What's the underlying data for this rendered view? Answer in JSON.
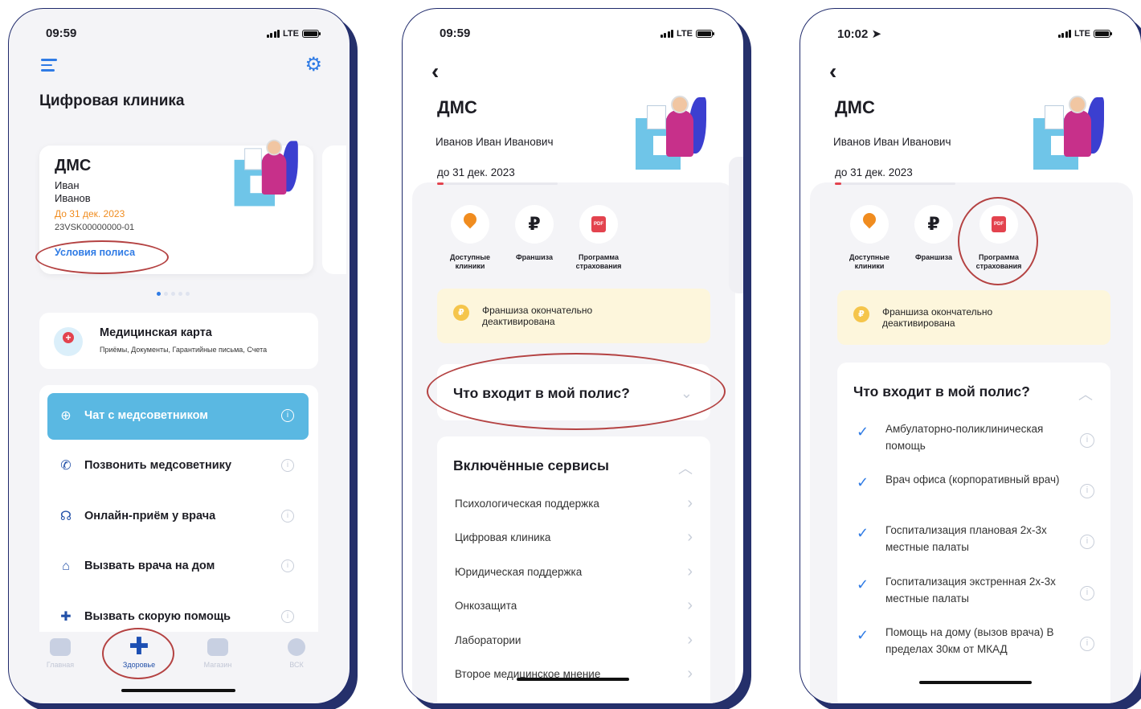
{
  "phone1": {
    "time": "09:59",
    "network": "LTE",
    "title": "Цифровая клиника",
    "card": {
      "heading": "ДМС",
      "first_name": "Иван",
      "last_name": "Иванов",
      "valid_until": "До 31 дек. 2023",
      "policy_number": "23VSK00000000-01",
      "conditions_link": "Условия полиса"
    },
    "medcard": {
      "title": "Медицинская карта",
      "subtitle": "Приёмы, Документы, Гарантийные письма, Счета"
    },
    "menu": [
      {
        "label": "Чат с медсоветником",
        "icon": "chat-icon"
      },
      {
        "label": "Позвонить медсоветнику",
        "icon": "phone-icon"
      },
      {
        "label": "Онлайн-приём у врача",
        "icon": "headset-icon"
      },
      {
        "label": "Вызвать врача на дом",
        "icon": "home-icon"
      },
      {
        "label": "Вызвать скорую помощь",
        "icon": "ambulance-icon"
      }
    ],
    "tabs": [
      {
        "label": "Главная",
        "icon": "home-tab-icon"
      },
      {
        "label": "Здоровье",
        "icon": "plus-tab-icon"
      },
      {
        "label": "Магазин",
        "icon": "cart-tab-icon"
      },
      {
        "label": "ВСК",
        "icon": "vsk-tab-icon"
      }
    ]
  },
  "phone2": {
    "time": "09:59",
    "network": "LTE",
    "heading": "ДМС",
    "full_name": "Иванов Иван Иванович",
    "valid_until": "до 31 дек. 2023",
    "validity_progress": 0.05,
    "services": [
      {
        "label": "Доступные клиники",
        "icon": "map-pin-icon"
      },
      {
        "label": "Франшиза",
        "icon": "ruble-icon"
      },
      {
        "label": "Программа страхования",
        "icon": "pdf-icon"
      }
    ],
    "franchise_notice": "Франшиза окончательно деактивирована",
    "policy_question": "Что входит в мой полис?",
    "included_heading": "Включённые сервисы",
    "included": [
      "Психологическая поддержка",
      "Цифровая клиника",
      "Юридическая поддержка",
      "Онкозащита",
      "Лаборатории",
      "Второе медицинское мнение"
    ]
  },
  "phone3": {
    "time": "10:02",
    "network": "LTE",
    "heading": "ДМС",
    "full_name": "Иванов Иван Иванович",
    "valid_until": "до 31 дек. 2023",
    "validity_progress": 0.05,
    "services": [
      {
        "label": "Доступные клиники",
        "icon": "map-pin-icon"
      },
      {
        "label": "Франшиза",
        "icon": "ruble-icon"
      },
      {
        "label": "Программа страхования",
        "icon": "pdf-icon"
      }
    ],
    "franchise_notice": "Франшиза окончательно деактивирована",
    "policy_question": "Что входит в мой полис?",
    "coverage": [
      "Амбулаторно-поликлиническая помощь",
      "Врач офиса (корпоративный врач)",
      "Госпитализация плановая 2х-3х местные палаты",
      "Госпитализация экстренная 2х-3х местные палаты",
      "Помощь на дому (вызов врача) В пределах 30км от МКАД"
    ]
  },
  "colors": {
    "accent_blue": "#2f7be5",
    "active_item": "#5ab8e2",
    "date_orange": "#f08c1f",
    "highlight_red": "#b44242",
    "notice_yellow": "#fdf6dc"
  }
}
